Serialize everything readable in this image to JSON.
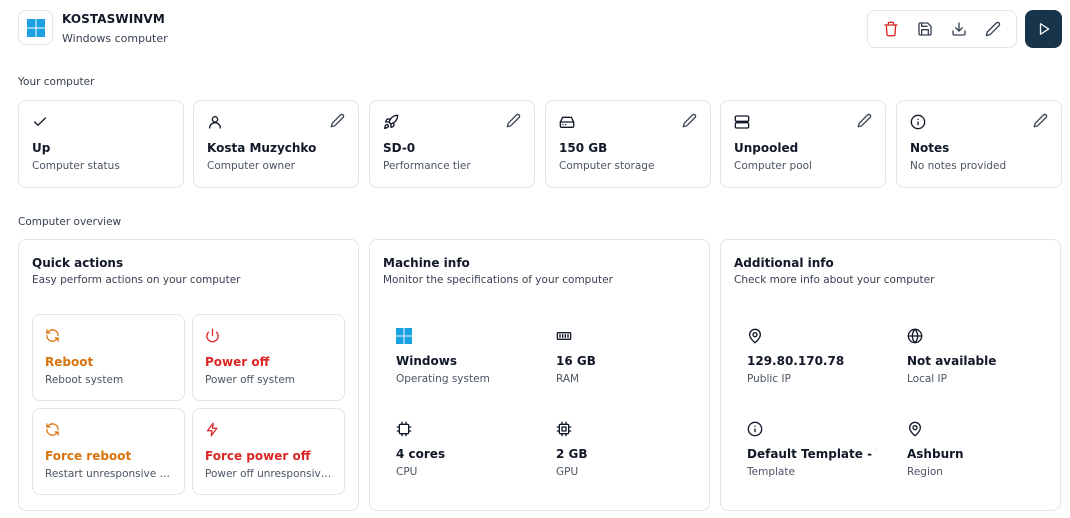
{
  "header": {
    "title": "KOSTASWINVM",
    "subtitle": "Windows computer",
    "icon": "windows-logo-icon"
  },
  "toolbar": {
    "buttons": [
      {
        "name": "delete",
        "icon": "trash-icon"
      },
      {
        "name": "save",
        "icon": "save-icon"
      },
      {
        "name": "download",
        "icon": "download-icon"
      },
      {
        "name": "edit",
        "icon": "pencil-icon"
      }
    ],
    "run_icon": "play-icon"
  },
  "sections": {
    "your_computer": "Your computer",
    "overview": "Computer overview"
  },
  "stats": [
    {
      "value": "Up",
      "label": "Computer status",
      "icon": "check-icon",
      "editable": false
    },
    {
      "value": "Kosta Muzychko",
      "label": "Computer owner",
      "icon": "user-icon",
      "editable": true
    },
    {
      "value": "SD-0",
      "label": "Performance tier",
      "icon": "rocket-icon",
      "editable": true
    },
    {
      "value": "150 GB",
      "label": "Computer storage",
      "icon": "hard-drive-icon",
      "editable": true
    },
    {
      "value": "Unpooled",
      "label": "Computer pool",
      "icon": "server-icon",
      "editable": true
    },
    {
      "value": "Notes",
      "label": "No notes provided",
      "icon": "info-icon",
      "editable": true
    }
  ],
  "quick_actions": {
    "title": "Quick actions",
    "subtitle": "Easy perform actions on your computer",
    "items": [
      {
        "name": "Reboot",
        "desc": "Reboot system",
        "icon": "refresh-icon",
        "color": "#d9730d"
      },
      {
        "name": "Power off",
        "desc": "Power off system",
        "icon": "power-icon",
        "color": "#dc2626"
      },
      {
        "name": "Force reboot",
        "desc": "Restart unresponsive system",
        "icon": "refresh-icon",
        "color": "#d9730d"
      },
      {
        "name": "Force power off",
        "desc": "Power off unresponsive system",
        "icon": "lightning-icon",
        "color": "#dc2626"
      }
    ]
  },
  "machine_info": {
    "title": "Machine info",
    "subtitle": "Monitor the specifications of your computer",
    "items": [
      {
        "value": "Windows",
        "label": "Operating system",
        "icon": "windows-logo-icon"
      },
      {
        "value": "16 GB",
        "label": "RAM",
        "icon": "memory-icon"
      },
      {
        "value": "4 cores",
        "label": "CPU",
        "icon": "cpu-icon"
      },
      {
        "value": "2 GB",
        "label": "GPU",
        "icon": "gpu-icon"
      }
    ]
  },
  "additional_info": {
    "title": "Additional info",
    "subtitle": "Check more info about your computer",
    "items": [
      {
        "value": "129.80.170.78",
        "label": "Public IP",
        "icon": "map-pin-icon"
      },
      {
        "value": "Not available",
        "label": "Local IP",
        "icon": "globe-icon"
      },
      {
        "value": "Default Template - Windows",
        "label": "Template",
        "icon": "info-icon"
      },
      {
        "value": "Ashburn",
        "label": "Region",
        "icon": "map-pin-icon"
      }
    ]
  },
  "colors": {
    "accent_dark": "#17344a",
    "warning": "#d9730d",
    "danger": "#dc2626",
    "windows_blue": "#1ba1e2"
  }
}
